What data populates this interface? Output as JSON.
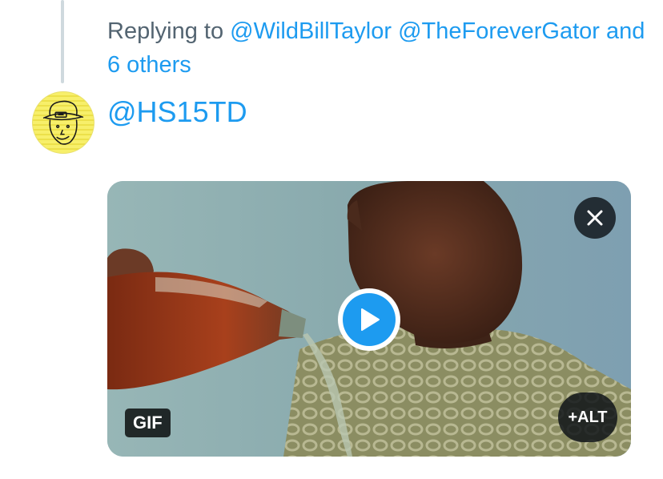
{
  "reply_context": {
    "prefix": "Replying to",
    "mentions": [
      "@WildBillTaylor",
      "@TheForeverGator"
    ],
    "others": "and 6 others"
  },
  "composer": {
    "text": "@HS15TD",
    "avatar_icon": "leprechaun-doodle-avatar"
  },
  "media": {
    "type_badge": "GIF",
    "alt_label": "+ALT",
    "remove_icon": "close-icon",
    "play_icon": "play-icon"
  },
  "colors": {
    "accent": "#1d9bf0",
    "secondary_text": "#536471",
    "thread_line": "#cfd9de"
  }
}
